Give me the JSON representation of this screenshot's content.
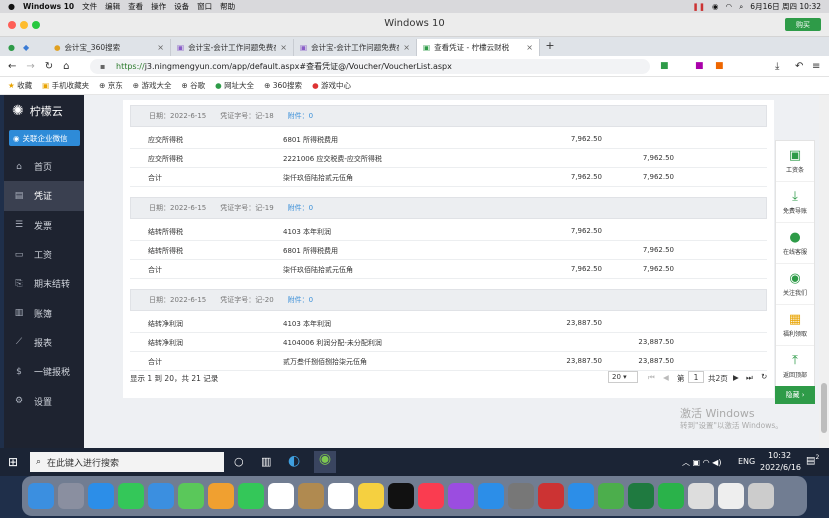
{
  "mac_menu": {
    "apple": "",
    "items": [
      "Windows 10",
      "文件",
      "编辑",
      "查看",
      "操作",
      "设备",
      "窗口",
      "帮助"
    ],
    "clock": "6月16日 周四 10:32"
  },
  "window": {
    "title": "Windows 10",
    "buy": "购买"
  },
  "tabs": [
    {
      "label": "会计宝_360搜索"
    },
    {
      "label": "会计宝-会计工作问题免费在线"
    },
    {
      "label": "会计宝-会计工作问题免费在线"
    },
    {
      "label": "查看凭证 - 柠檬云财税"
    }
  ],
  "address": {
    "proto": "https://",
    "url": "j3.ningmengyun.com/app/default.aspx#查看凭证@/Voucher/VoucherList.aspx"
  },
  "bookmarks": [
    "收藏",
    "手机收藏夹",
    "京东",
    "游戏大全",
    "谷歌",
    "网址大全",
    "360搜索",
    "游戏中心"
  ],
  "app": {
    "logo": "柠檬云",
    "wechat": "关联企业微信",
    "nav": [
      {
        "label": "首页",
        "icon": "home-icon",
        "glyph": "⌂"
      },
      {
        "label": "凭证",
        "icon": "voucher-icon",
        "glyph": "▤",
        "active": true
      },
      {
        "label": "发票",
        "icon": "invoice-icon",
        "glyph": "☰"
      },
      {
        "label": "工资",
        "icon": "salary-icon",
        "glyph": "▭"
      },
      {
        "label": "期末结转",
        "icon": "close-period-icon",
        "glyph": "⎘"
      },
      {
        "label": "账簿",
        "icon": "book-icon",
        "glyph": "▥"
      },
      {
        "label": "报表",
        "icon": "report-icon",
        "glyph": "⟋"
      },
      {
        "label": "一键报税",
        "icon": "tax-icon",
        "glyph": "$"
      },
      {
        "label": "设置",
        "icon": "settings-icon",
        "glyph": "⚙"
      }
    ]
  },
  "vouchers": [
    {
      "date": "日期：2022-6-15",
      "no": "凭证字号：记-18",
      "att": "附件：0",
      "rows": [
        {
          "summary": "应交所得税",
          "account": "6801 所得税费用",
          "debit": "7,962.50",
          "credit": ""
        },
        {
          "summary": "应交所得税",
          "account": "2221006 应交税费-应交所得税",
          "debit": "",
          "credit": "7,962.50"
        },
        {
          "summary": "合计",
          "account": "柒仟玖佰陆拾贰元伍角",
          "debit": "7,962.50",
          "credit": "7,962.50"
        }
      ]
    },
    {
      "date": "日期：2022-6-15",
      "no": "凭证字号：记-19",
      "att": "附件：0",
      "rows": [
        {
          "summary": "结转所得税",
          "account": "4103 本年利润",
          "debit": "7,962.50",
          "credit": ""
        },
        {
          "summary": "结转所得税",
          "account": "6801 所得税费用",
          "debit": "",
          "credit": "7,962.50"
        },
        {
          "summary": "合计",
          "account": "柒仟玖佰陆拾贰元伍角",
          "debit": "7,962.50",
          "credit": "7,962.50"
        }
      ]
    },
    {
      "date": "日期：2022-6-15",
      "no": "凭证字号：记-20",
      "att": "附件：0",
      "rows": [
        {
          "summary": "结转净利润",
          "account": "4103 本年利润",
          "debit": "23,887.50",
          "credit": ""
        },
        {
          "summary": "结转净利润",
          "account": "4104006 利润分配-未分配利润",
          "debit": "",
          "credit": "23,887.50"
        },
        {
          "summary": "合计",
          "account": "贰万叁仟捌佰捌拾柒元伍角",
          "debit": "23,887.50",
          "credit": "23,887.50"
        }
      ]
    }
  ],
  "pager": {
    "info": "显示 1 到 20，共 21 记录",
    "size": "20",
    "page_prefix": "第",
    "page": "1",
    "total": "共2页"
  },
  "float": [
    "工资条",
    "免费导账",
    "在线客服",
    "关注我们",
    "福利领取",
    "返回顶部"
  ],
  "hide": "隐藏 ›",
  "activate": {
    "line1": "激活 Windows",
    "line2": "转到\"设置\"以激活 Windows。"
  },
  "taskbar": {
    "search": "在此键入进行搜索",
    "lang": "ENG",
    "time": "10:32",
    "date": "2022/6/16",
    "notif": "2"
  },
  "colors": {
    "accent": "#2e9b48",
    "sidebar": "#1e2330",
    "link": "#3a8fd8"
  }
}
